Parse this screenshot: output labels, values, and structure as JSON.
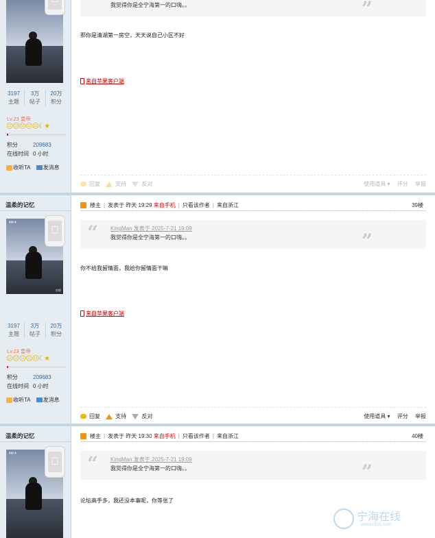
{
  "common": {
    "author": "温柔的记忆",
    "stats": [
      {
        "num": "3197",
        "label": "主题"
      },
      {
        "num": "3万",
        "label": "帖子"
      },
      {
        "num": "20万",
        "label": "积分"
      }
    ],
    "level": "Lv.23 皇帝",
    "medals": "😐😐😐😐😐☾★",
    "credits_label": "积分",
    "credits_value": "209683",
    "online_label": "在线时间",
    "online_value": "0 小时",
    "follow_label": "收听TA",
    "message_label": "发消息",
    "from_client": "来自苹果客户端",
    "quote_head": "KingMan 发表于 2025-7-21 19:09",
    "quote_body": "我觉得你是全宁海第一的口嗨。。",
    "reply_label": "回复",
    "support_label": "支持",
    "oppose_label": "反对",
    "tools_label": "使用道具",
    "rate_label": "评分",
    "report_label": "举报",
    "louzhu": "楼主",
    "from_mobile": "来自手机",
    "only_author": "只看该作者",
    "from_region": "来自浙江"
  },
  "post1": {
    "quote_body": "我觉得你是全宁海第一的口嗨。。",
    "message": "那你是清湖第一房空，天天说自己小区不好"
  },
  "post2": {
    "posted": "发表于 昨天 19:29",
    "floor": "39楼",
    "message": "你不给我留情面，我给你留情面干嘛"
  },
  "post3": {
    "posted": "发表于 昨天 19:30",
    "floor": "40楼",
    "message": "论坛高手多，我还没本事呢，你等张了"
  },
  "watermark": {
    "text": "宁海在线",
    "url": "www.nhzj.com"
  },
  "avatar": {
    "status": "▮▮▮ ◉",
    "wm": "拍摄"
  },
  "colors": {
    "sidebar_bg": "#e5edf2",
    "divider": "#c2d5e3",
    "accent_red": "#ff0000",
    "link_blue": "#336699"
  }
}
